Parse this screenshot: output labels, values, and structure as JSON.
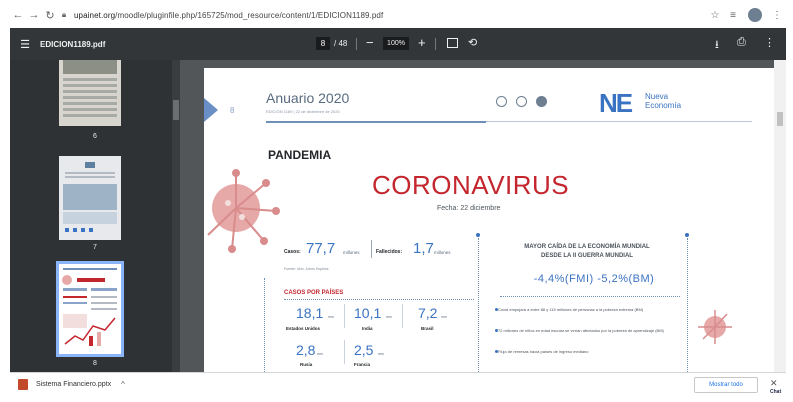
{
  "browser": {
    "url_host": "upainet.org",
    "url_path": "/moodle/pluginfile.php/165725/mod_resource/content/1/EDICION1189.pdf"
  },
  "pdf_toolbar": {
    "doc_name": "EDICION1189.pdf",
    "current_page": "8",
    "total_pages": "/ 48",
    "zoom": "100%"
  },
  "thumbnails": [
    {
      "number": "6"
    },
    {
      "number": "7"
    },
    {
      "number": "8"
    }
  ],
  "page": {
    "page_number": "8",
    "header_title": "Anuario 2020",
    "header_sub": "EDICIÓN 1189 | 22 de diciembre de 2020",
    "logo_mark": "NE",
    "logo_text_1": "Nueva",
    "logo_text_2": "Economía",
    "section": "PANDEMIA",
    "title": "CORONAVIRUS",
    "date": "Fecha: 22 diciembre",
    "stats": {
      "cases_label": "Casos:",
      "cases_value": "77,7",
      "cases_unit": "millones",
      "deaths_label": "Fallecidos:",
      "deaths_value": "1,7",
      "deaths_unit": "millones",
      "source": "Fuente: Univ. Johns Hopkins"
    },
    "countries_title": "CASOS POR PAÍSES",
    "countries": [
      {
        "value": "18,1",
        "unit": "mm",
        "name": "Estados Unidos"
      },
      {
        "value": "10,1",
        "unit": "mm",
        "name": "India"
      },
      {
        "value": "7,2",
        "unit": "mm",
        "name": "Brasil"
      },
      {
        "value": "2,8",
        "unit": "mm",
        "name": "Rusia"
      },
      {
        "value": "2,5",
        "unit": "mm",
        "name": "Francia"
      }
    ],
    "economy": {
      "title_1": "MAYOR CAÍDA DE LA ECONOMÍA MUNDIAL",
      "title_2": "DESDE LA II GUERRA MUNDIAL",
      "value": "-4,4%(FMI) -5,2%(BM)",
      "bullets": [
        "Covid empujará a entre 88 y 115 millones de personas a la pobreza extrema (BM)",
        "72 millones de niños en edad escolar se verían afectados por la pobreza de aprendizaje (BM)",
        "Flujo de remesas hacia países de ingreso mediano"
      ]
    }
  },
  "download_bar": {
    "file_name": "Sistema Financiero.pptx",
    "show_all": "Mostrar todo",
    "chat": "Chat"
  }
}
